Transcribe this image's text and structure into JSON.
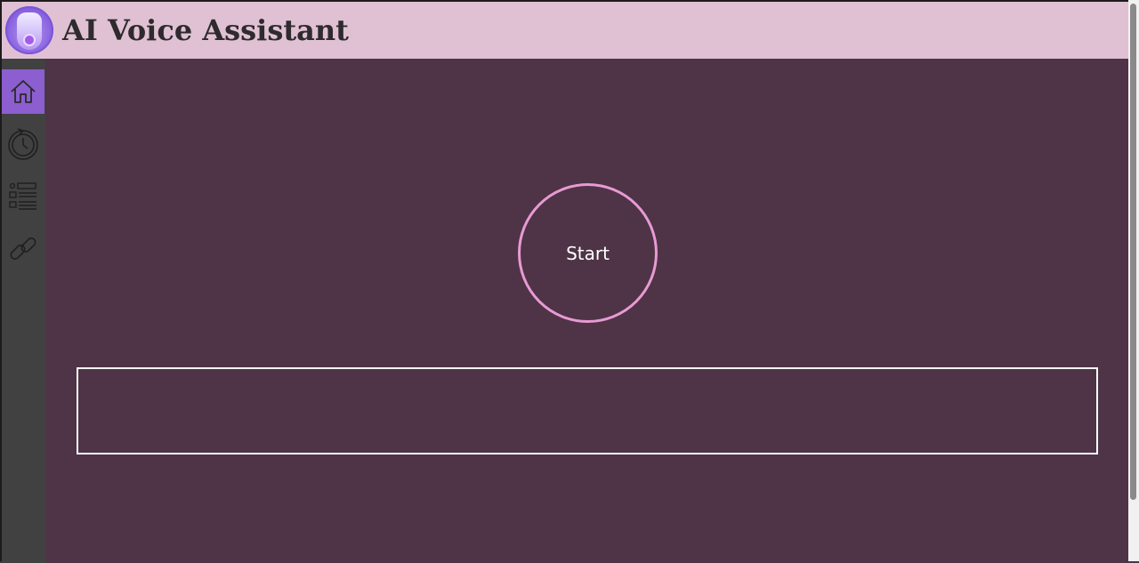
{
  "header": {
    "title": "AI Voice Assistant",
    "logo_icon": "voice-assistant-logo-icon"
  },
  "sidebar": {
    "items": [
      {
        "icon": "home-icon",
        "active": true
      },
      {
        "icon": "history-clock-icon",
        "active": false
      },
      {
        "icon": "list-icon",
        "active": false
      },
      {
        "icon": "link-icon",
        "active": false
      }
    ]
  },
  "main": {
    "start_label": "Start",
    "transcript_text": ""
  },
  "colors": {
    "header_bg": "#e0c1d4",
    "main_bg": "#4e3446",
    "sidebar_bg": "#414141",
    "active_nav": "#8c5ed0",
    "start_ring": "#e89ad4"
  }
}
